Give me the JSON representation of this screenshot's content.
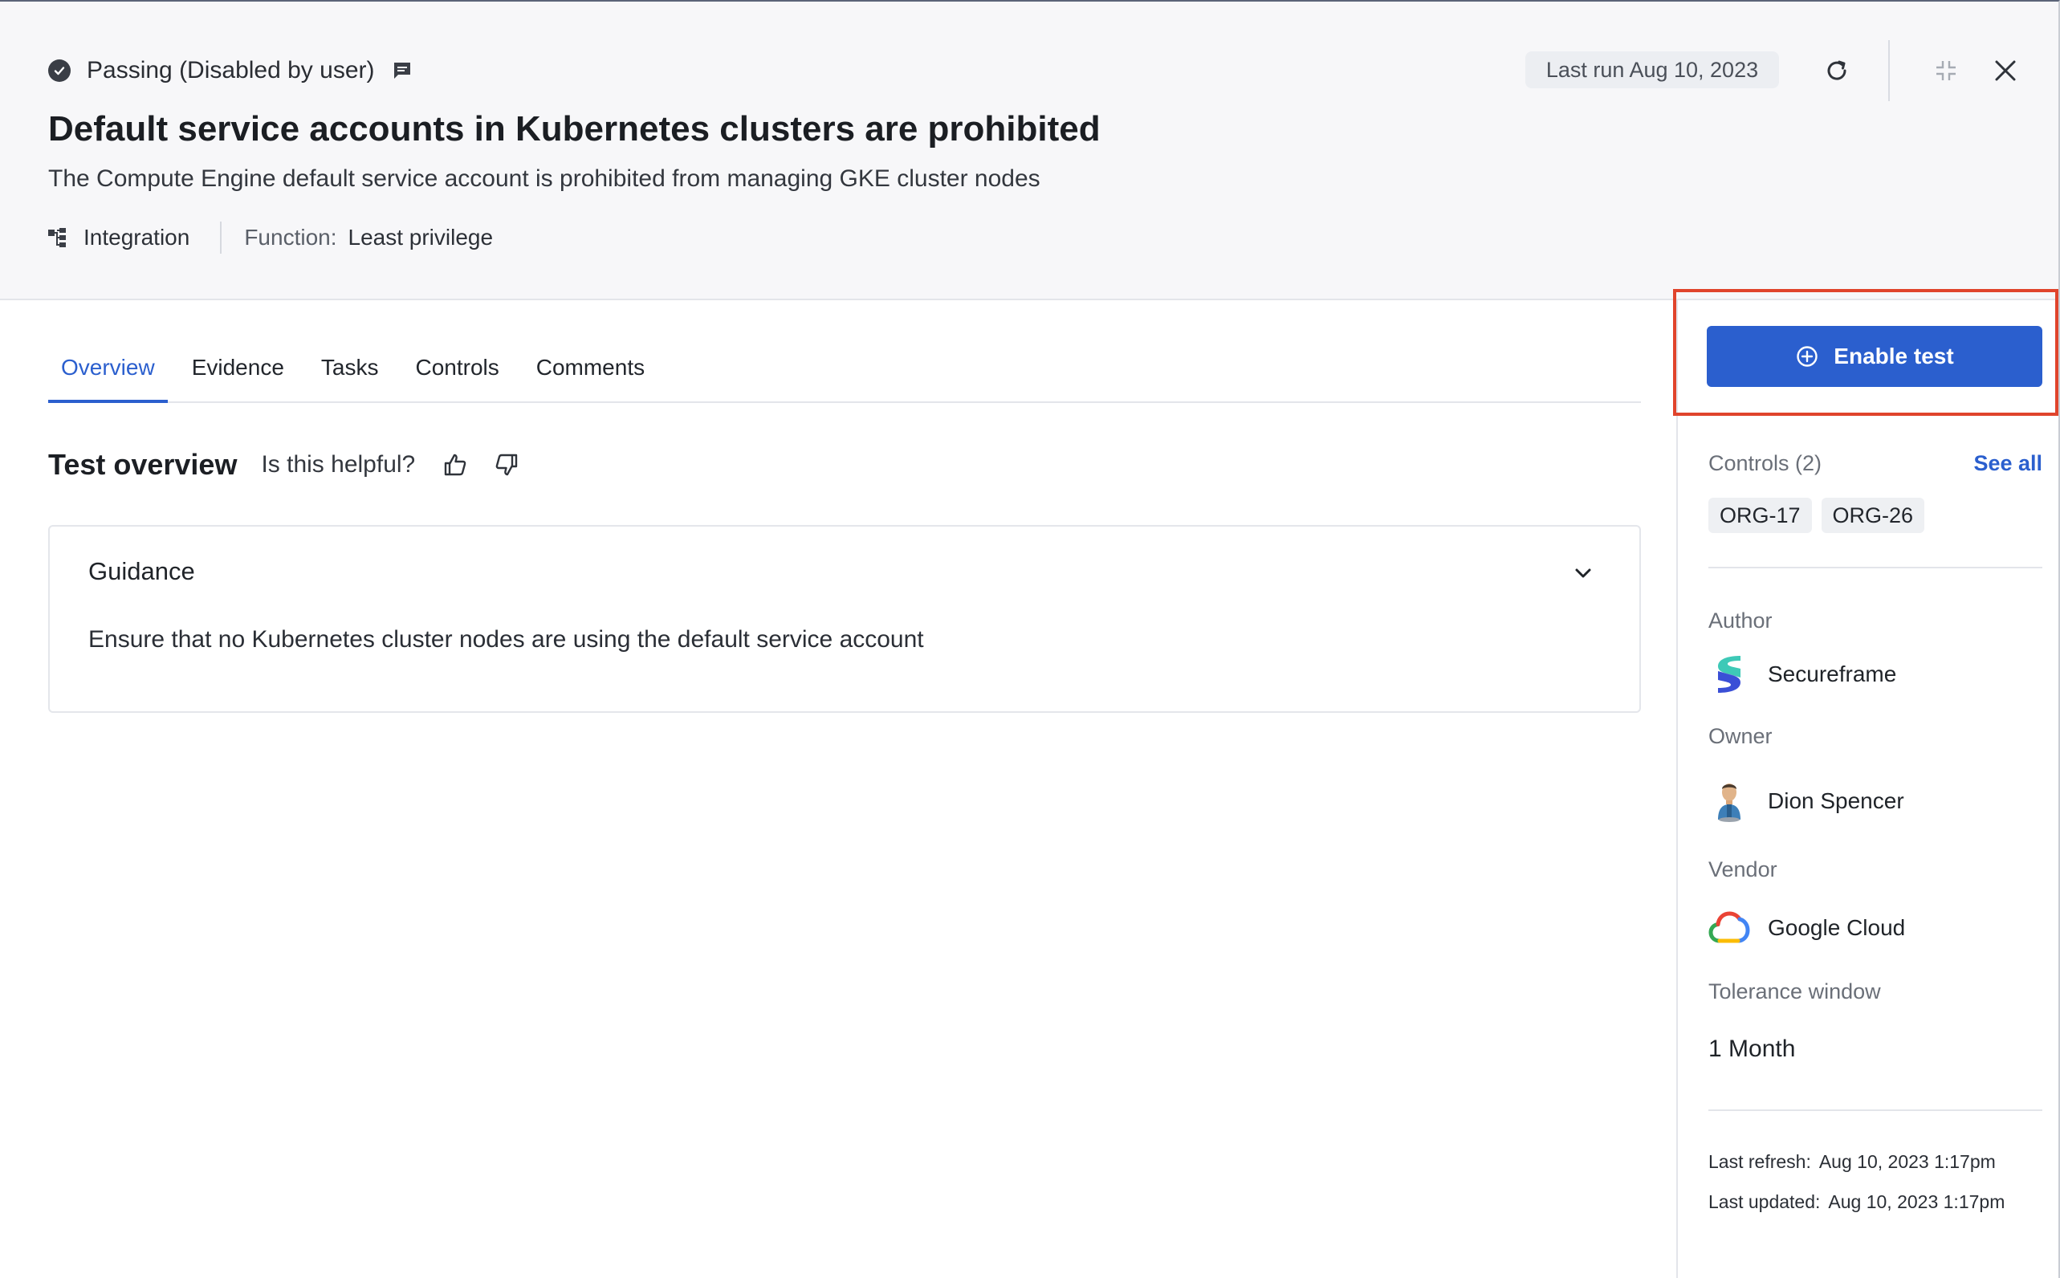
{
  "header": {
    "status_text": "Passing (Disabled by user)",
    "title": "Default service accounts in Kubernetes clusters are prohibited",
    "subtitle": "The Compute Engine default service account is prohibited from managing GKE cluster nodes",
    "type_label": "Integration",
    "function_key": "Function:",
    "function_value": "Least privilege",
    "last_run": "Last run Aug 10, 2023"
  },
  "tabs": [
    {
      "label": "Overview",
      "active": true
    },
    {
      "label": "Evidence",
      "active": false
    },
    {
      "label": "Tasks",
      "active": false
    },
    {
      "label": "Controls",
      "active": false
    },
    {
      "label": "Comments",
      "active": false
    }
  ],
  "overview": {
    "title": "Test overview",
    "helpful_prompt": "Is this helpful?"
  },
  "guidance": {
    "title": "Guidance",
    "text": "Ensure that no Kubernetes cluster nodes are using the default service account"
  },
  "sidebar": {
    "enable_button": "Enable test",
    "controls_label": "Controls (2)",
    "see_all": "See all",
    "controls": [
      "ORG-17",
      "ORG-26"
    ],
    "author_label": "Author",
    "author_name": "Secureframe",
    "owner_label": "Owner",
    "owner_name": "Dion Spencer",
    "vendor_label": "Vendor",
    "vendor_name": "Google Cloud",
    "tolerance_label": "Tolerance window",
    "tolerance_value": "1 Month",
    "last_refresh_key": "Last refresh:",
    "last_refresh_value": "Aug 10, 2023 1:17pm",
    "last_updated_key": "Last updated:",
    "last_updated_value": "Aug 10, 2023 1:17pm"
  },
  "colors": {
    "accent": "#2b5fce",
    "highlight": "#e0442c",
    "header_bg": "#f7f7f9"
  }
}
